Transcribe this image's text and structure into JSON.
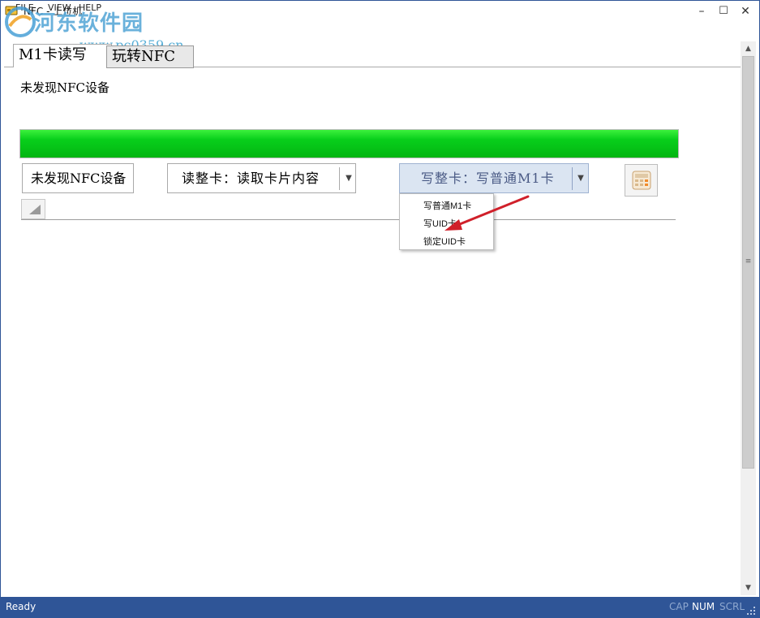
{
  "window": {
    "title": "NFC - 上位机",
    "controls": {
      "minimize": "–",
      "maximize": "☐",
      "close": "✕"
    },
    "icon": "app-card-icon"
  },
  "menu": {
    "file": "FILE",
    "view": "VIEW",
    "help": "HELP"
  },
  "watermark": {
    "title": "河东软件园",
    "url": "www.pc0359.cn"
  },
  "tabs": [
    {
      "label": "M1卡读写",
      "active": true
    },
    {
      "label": "玩转NFC",
      "active": false
    }
  ],
  "main": {
    "status_label": "未发现NFC设备",
    "progress": {
      "fraction": 1.0,
      "color": "#08cf1b"
    },
    "device_button": "未发现NFC设备",
    "read_combo": {
      "value": "读整卡：读取卡片内容",
      "arrow": "▼"
    },
    "write_combo": {
      "value": "写整卡：写普通M1卡",
      "arrow": "▼"
    },
    "calc_button_icon": "calculator-icon",
    "write_menu": [
      "写普通M1卡",
      "写UID卡",
      "锁定UID卡"
    ]
  },
  "scrollbar": {
    "up": "▲",
    "down": "▼",
    "grip": "≡"
  },
  "statusbar": {
    "ready": "Ready",
    "cap": "CAP",
    "num": "NUM",
    "scrl": "SCRL"
  },
  "colors": {
    "statusbar": "#2f5597",
    "progress_green": "#08cf1b",
    "annotation_arrow": "#d0202a"
  }
}
